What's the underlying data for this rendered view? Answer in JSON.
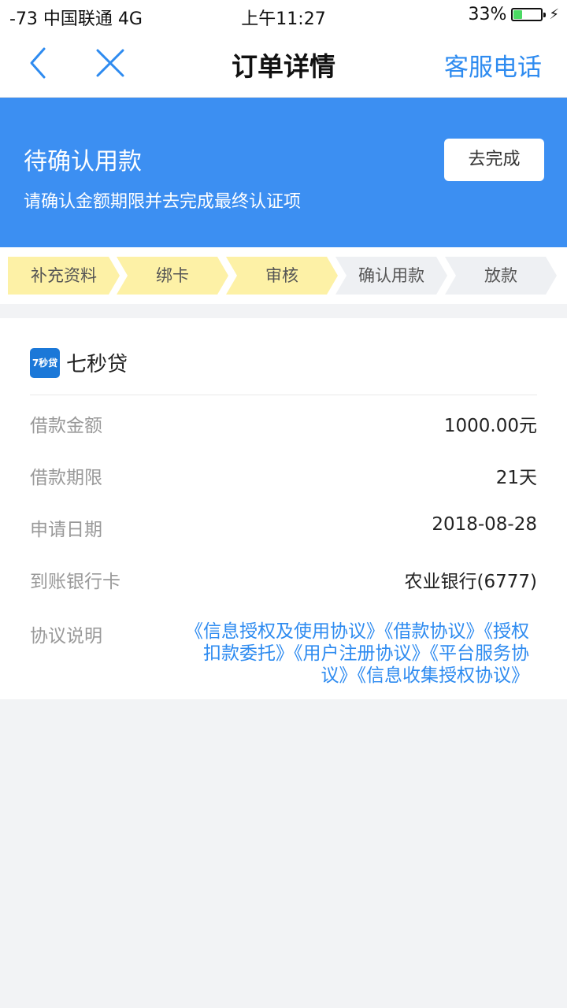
{
  "status_bar": {
    "carrier": "-73 中国联通   4G",
    "time": "上午11:27",
    "battery_percent_label": "33%",
    "battery_level": 0.33,
    "charging_icon": "bolt-icon"
  },
  "nav": {
    "back_icon": "chevron-left-icon",
    "close_icon": "close-icon",
    "title": "订单详情",
    "right_label": "客服电话",
    "accent_color": "#2e8bf0"
  },
  "banner": {
    "title": "待确认用款",
    "subtitle": "请确认金额期限并去完成最终认证项",
    "button_label": "去完成",
    "background_color": "#3c8ff2"
  },
  "steps": [
    {
      "label": "补充资料",
      "done": true
    },
    {
      "label": "绑卡",
      "done": true
    },
    {
      "label": "审核",
      "done": true
    },
    {
      "label": "确认用款",
      "done": false
    },
    {
      "label": "放款",
      "done": false
    }
  ],
  "lender": {
    "logo_text": "7秒贷",
    "name": "七秒贷"
  },
  "details": [
    {
      "label": "借款金额",
      "value": "1000.00元"
    },
    {
      "label": "借款期限",
      "value": "21天"
    },
    {
      "label": "申请日期",
      "value": "2018-08-28"
    },
    {
      "label": "到账银行卡",
      "value": "农业银行(6777)"
    }
  ],
  "agreements": {
    "label": "协议说明",
    "links": [
      "《信息授权及使用协议》",
      "《借款协议》",
      "《授权扣款委托》",
      "《用户注册协议》",
      "《平台服务协议》",
      "《信息收集授权协议》"
    ]
  }
}
